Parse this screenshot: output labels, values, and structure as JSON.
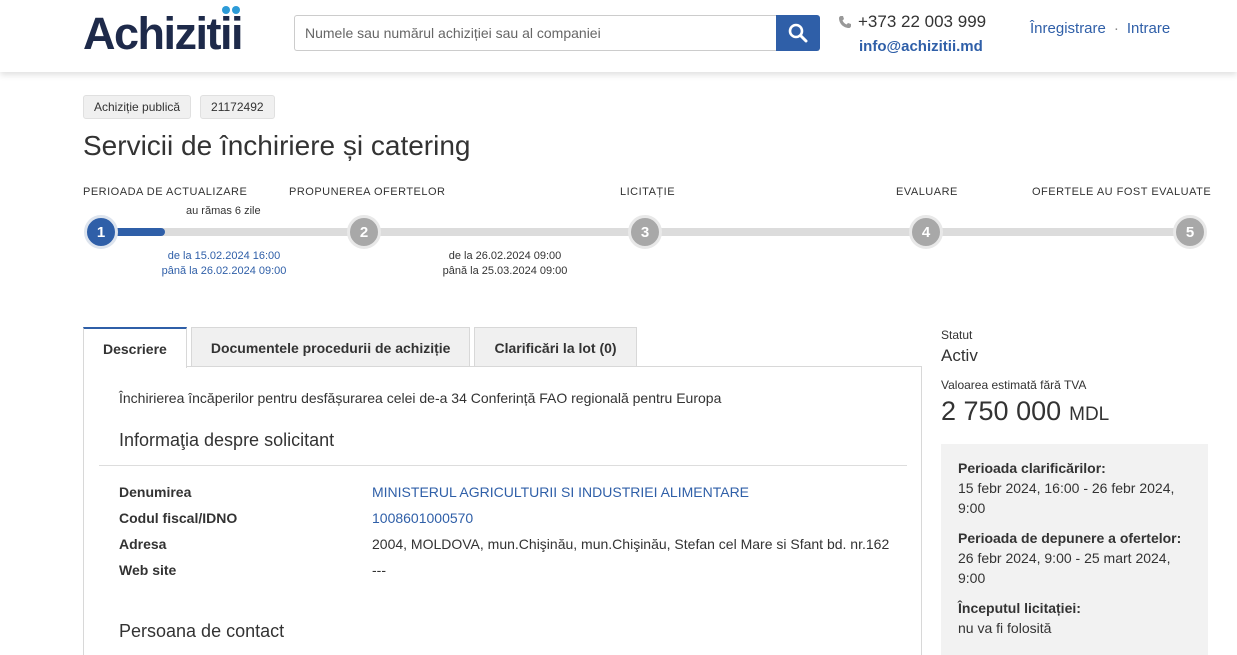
{
  "header": {
    "logo_text": "Achizitii",
    "search_placeholder": "Numele sau numărul achiziției sau al companiei",
    "phone": "+373 22 003 999",
    "email": "info@achizitii.md",
    "register_label": "Înregistrare",
    "separator": "·",
    "login_label": "Intrare"
  },
  "tags": [
    "Achiziție publică",
    "21172492"
  ],
  "page_title": "Servicii de închiriere și catering",
  "stepper": {
    "steps": [
      {
        "label": "PERIOADA DE ACTUALIZARE",
        "number": "1"
      },
      {
        "label": "PROPUNEREA OFERTELOR",
        "number": "2"
      },
      {
        "label": "LICITAȚIE",
        "number": "3"
      },
      {
        "label": "EVALUARE",
        "number": "4"
      },
      {
        "label": "OFERTELE AU FOST EVALUATE",
        "number": "5"
      }
    ],
    "remaining": "au rămas 6 zile",
    "progress_fraction": 0.06,
    "period1": {
      "from": "de la 15.02.2024 16:00",
      "to": "până la 26.02.2024 09:00"
    },
    "period2": {
      "from": "de la 26.02.2024 09:00",
      "to": "până la 25.03.2024 09:00"
    }
  },
  "tabs": [
    "Descriere",
    "Documentele procedurii de achiziție",
    "Clarificări la lot (0)"
  ],
  "description": "Închirierea încăperilor pentru desfășurarea celei de-a 34 Conferință FAO regională pentru Europa",
  "applicant": {
    "title": "Informaţia despre solicitant",
    "rows": [
      {
        "key": "Denumirea",
        "value": "MINISTERUL AGRICULTURII SI INDUSTRIEI ALIMENTARE"
      },
      {
        "key": "Codul fiscal/IDNO",
        "value": "1008601000570"
      },
      {
        "key": "Adresa",
        "value": "2004, MOLDOVA, mun.Chişinău, mun.Chişinău, Stefan cel Mare si Sfant bd. nr.162"
      },
      {
        "key": "Web site",
        "value": "---"
      }
    ]
  },
  "contact_title": "Persoana de contact",
  "sidebar": {
    "status_label": "Statut",
    "status_value": "Activ",
    "value_label": "Valoarea estimată fără TVA",
    "value_amount": "2 750 000",
    "value_currency": "MDL",
    "info": [
      {
        "heading": "Perioada clarificărilor:",
        "text": "15 febr 2024, 16:00 - 26 febr 2024, 9:00"
      },
      {
        "heading": "Perioada de depunere a ofertelor:",
        "text": "26 febr 2024, 9:00 - 25 mart 2024, 9:00"
      },
      {
        "heading": "Începutul licitației:",
        "text": "nu va fi folosită"
      }
    ]
  },
  "colors": {
    "primary": "#2f5fa8",
    "logo_dark": "#1e2a4a",
    "logo_dot": "#2d9bd7",
    "step_inactive": "#a8a8a8"
  }
}
